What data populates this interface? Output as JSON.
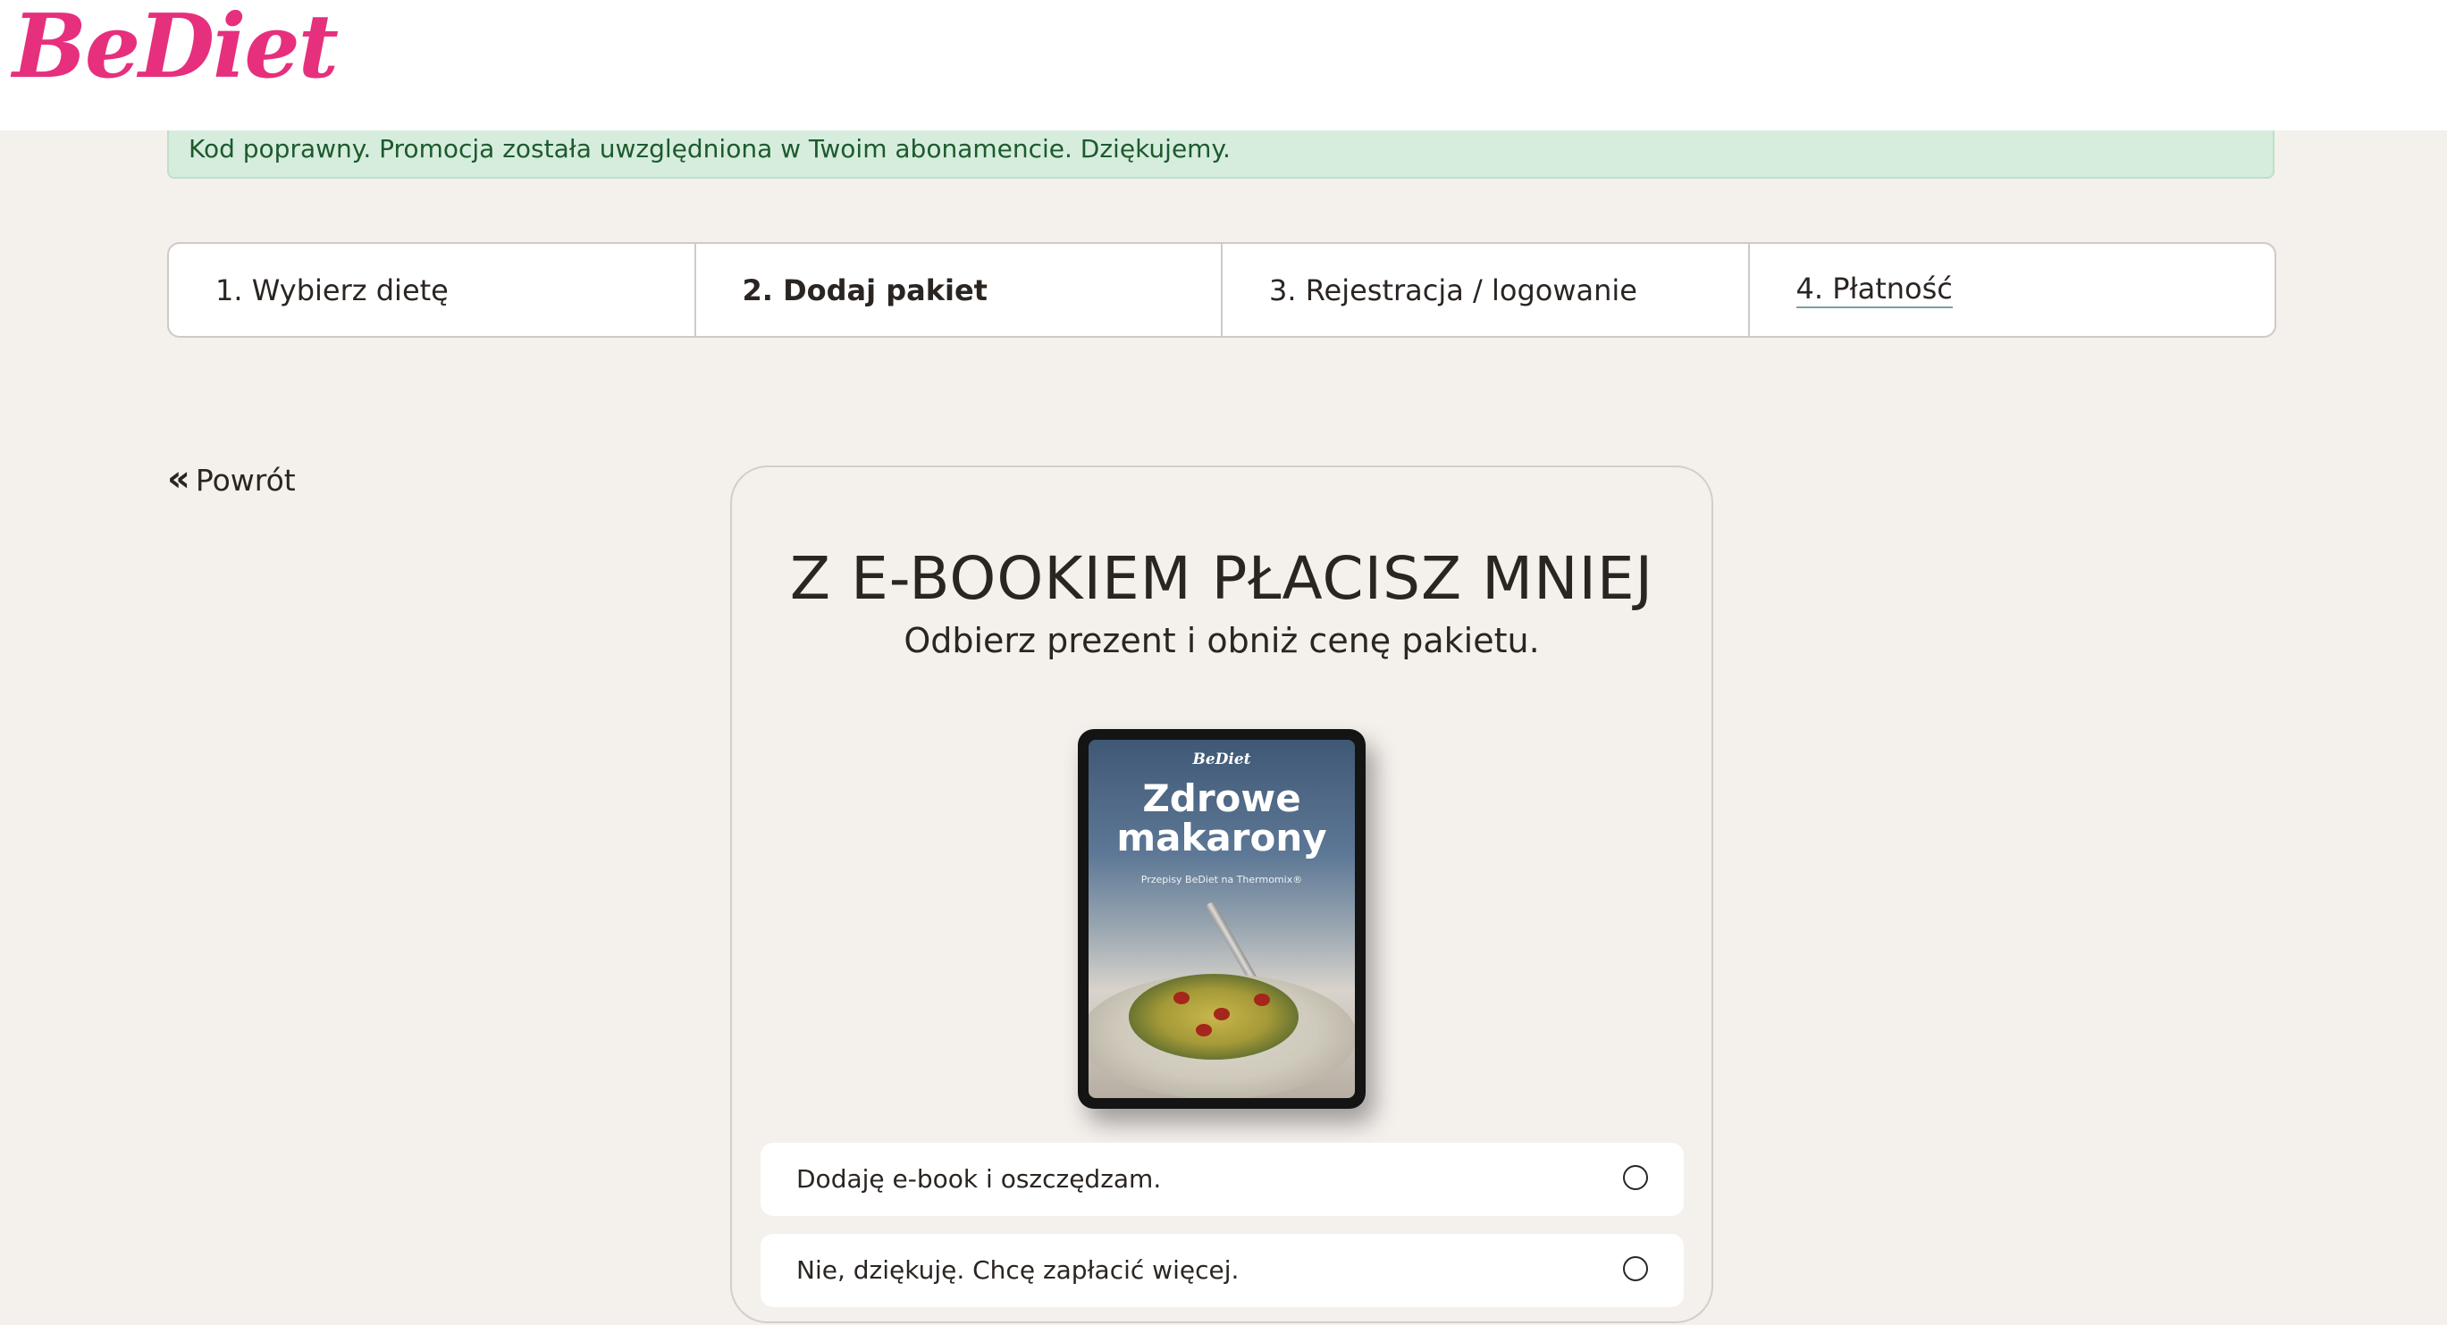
{
  "header": {
    "logo_text": "BeDiet"
  },
  "alert": {
    "message": "Kod poprawny. Promocja została uwzględniona w Twoim abonamencie. Dziękujemy."
  },
  "steps": [
    {
      "label": "1. Wybierz dietę"
    },
    {
      "label": "2. Dodaj pakiet"
    },
    {
      "label": "3. Rejestracja / logowanie"
    },
    {
      "label": "4. Płatność"
    }
  ],
  "back": {
    "icon": "double-chevron-left-icon",
    "label": "Powrót"
  },
  "offer": {
    "title": "Z E-BOOKIEM PŁACISZ MNIEJ",
    "subtitle": "Odbierz prezent i obniż cenę pakietu.",
    "ebook": {
      "brand": "BeDiet",
      "title_line1": "Zdrowe",
      "title_line2": "makarony",
      "subtitle": "Przepisy BeDiet na Thermomix®"
    },
    "options": [
      {
        "label": "Dodaję e-book i oszczędzam.",
        "selected": false
      },
      {
        "label": "Nie, dziękuję. Chcę zapłacić więcej.",
        "selected": false
      }
    ]
  },
  "colors": {
    "brand": "#e6307d",
    "alert_bg": "#d6eddd",
    "page_bg": "#f4f0ec"
  }
}
